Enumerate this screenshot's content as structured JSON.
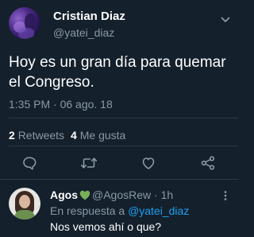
{
  "tweet": {
    "author_name": "Cristian Diaz",
    "author_handle": "@yatei_diaz",
    "text": "Hoy es un gran día para quemar el Congreso.",
    "timestamp": "1:35 PM · 06 ago. 18",
    "retweets_count": "2",
    "retweets_label": "Retweets",
    "likes_count": "4",
    "likes_label": "Me gusta"
  },
  "actions": {
    "icons": [
      "reply-icon",
      "retweet-icon",
      "like-icon",
      "share-icon"
    ]
  },
  "reply": {
    "author_name": "Agos",
    "author_handle": "@AgosRew",
    "separator": "·",
    "time": "1h",
    "in_reply_to_label": "En respuesta a",
    "in_reply_to_handle": "@yatei_diaz",
    "text": "Nos vemos ahí o que?"
  },
  "colors": {
    "background": "#14202c",
    "secondary_text": "#8899a6",
    "link": "#1da1f2",
    "divider": "#283a4b",
    "heart_emoji": "#78b159"
  }
}
